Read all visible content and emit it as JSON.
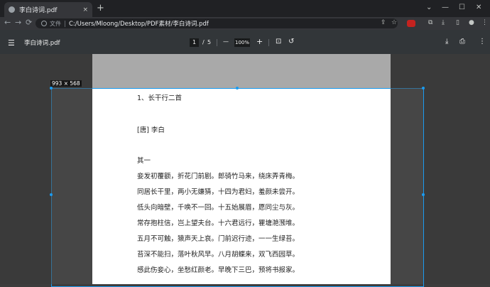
{
  "tab": {
    "title": "李白诗词.pdf",
    "close": "×",
    "new_tab": "+"
  },
  "window_controls": {
    "collapse": "⌄",
    "minimize": "—",
    "maximize": "☐",
    "close": "✕"
  },
  "toolbar": {
    "back": "←",
    "forward": "→",
    "reload": "⟳",
    "omnibox_label": "文件",
    "url": "C:/Users/Mloong/Desktop/PDF素材/李白诗词.pdf",
    "share": "⇪",
    "bookmark": "☆",
    "extensions": "⧉",
    "side_panel": "▯",
    "profile": "●",
    "more": "⋮"
  },
  "pdf_toolbar": {
    "menu": "☰",
    "title": "李白诗词.pdf",
    "current_page": "1",
    "page_separator": "/",
    "total_pages": "5",
    "zoom_out": "—",
    "zoom": "100%",
    "zoom_in": "+",
    "fit": "⊡",
    "rotate": "↺",
    "download": "⤓",
    "print": "⎙",
    "more": "⋮"
  },
  "selection": {
    "dimensions": "993 × 568"
  },
  "poem": {
    "heading": "1、长干行二首",
    "author": "[唐] 李白",
    "part": "其一",
    "lines": [
      "妾发初覆额，折花门前剧。郎骑竹马来，绕床弄青梅。",
      "同居长干里，两小无嫌猜，十四为君妇，羞颜未尝开。",
      "低头向暗壁，千唤不一回。十五始展眉，愿同尘与灰。",
      "常存抱柱信，岂上望夫台。十六君远行，瞿塘滟滪堆。",
      "五月不可触，猿声天上哀。门前迟行迹，一一生绿苔。",
      "苔深不能扫，落叶秋风早。八月胡蝶来，双飞西园草。",
      "感此伤妾心，坐愁红颜老。早晚下三巴，预将书报家。"
    ]
  },
  "colors": {
    "selection_border": "#1a9bf0",
    "browser_dark": "#202124",
    "pdf_toolbar": "#323639"
  }
}
